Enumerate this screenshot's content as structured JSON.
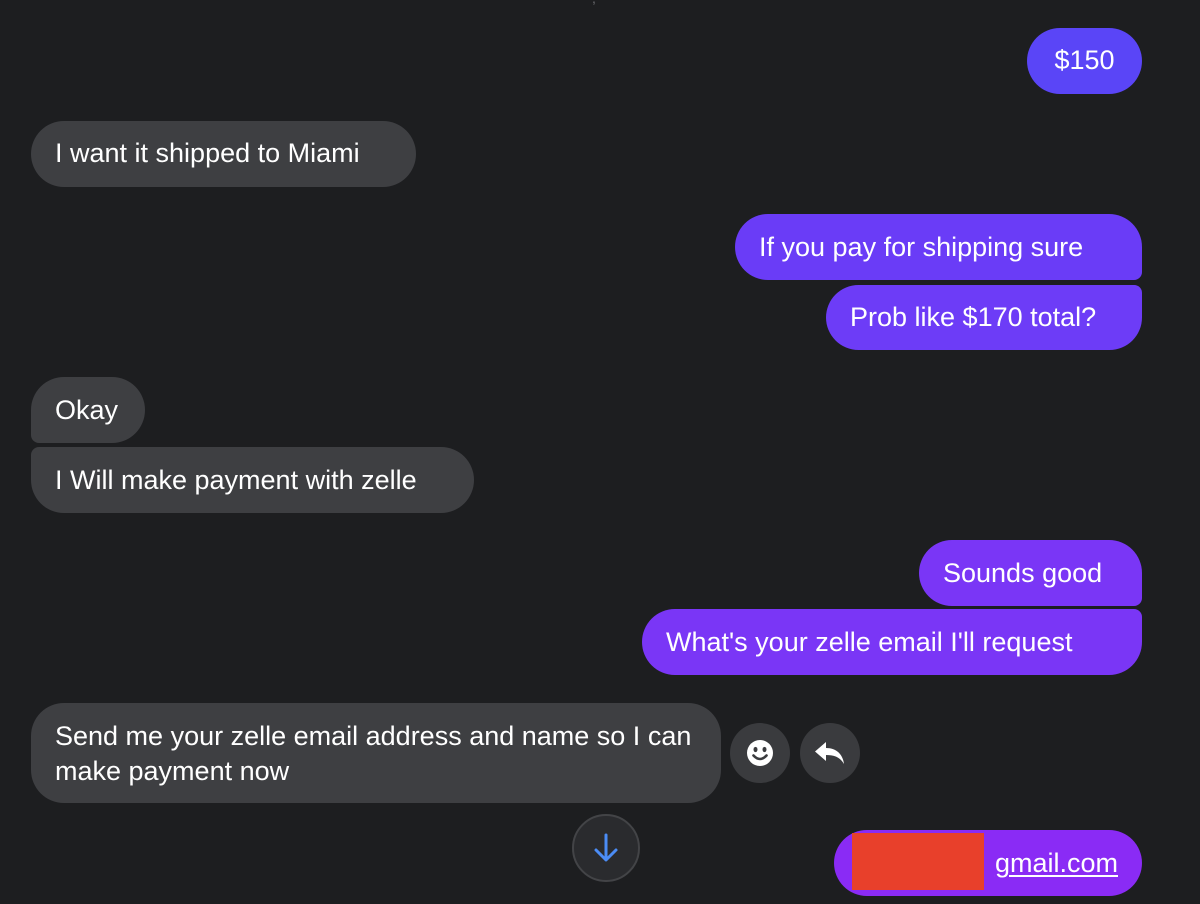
{
  "messages": {
    "amount": "$150",
    "shipped_miami": "I want it shipped to Miami",
    "pay_shipping": "If you pay for shipping sure",
    "prob_total": "Prob like $170 total?",
    "okay": "Okay",
    "zelle_payment": "I Will make payment with zelle",
    "sounds_good": "Sounds good",
    "whats_zelle": "What's your zelle email I'll request",
    "send_email": "Send me your zelle email address and name so I can make payment  now",
    "email_visible": "gmail.com"
  },
  "icons": {
    "react": "smiley-face-icon",
    "reply": "reply-arrow-icon",
    "scroll": "arrow-down-icon"
  },
  "colors": {
    "background": "#1d1e20",
    "incoming_bubble": "#3e3f42",
    "outgoing_bubble_blue": "#5a45f7",
    "outgoing_bubble_purple": "#7a36f6",
    "redaction": "#e8402b",
    "scroll_arrow": "#4b8cf5"
  }
}
